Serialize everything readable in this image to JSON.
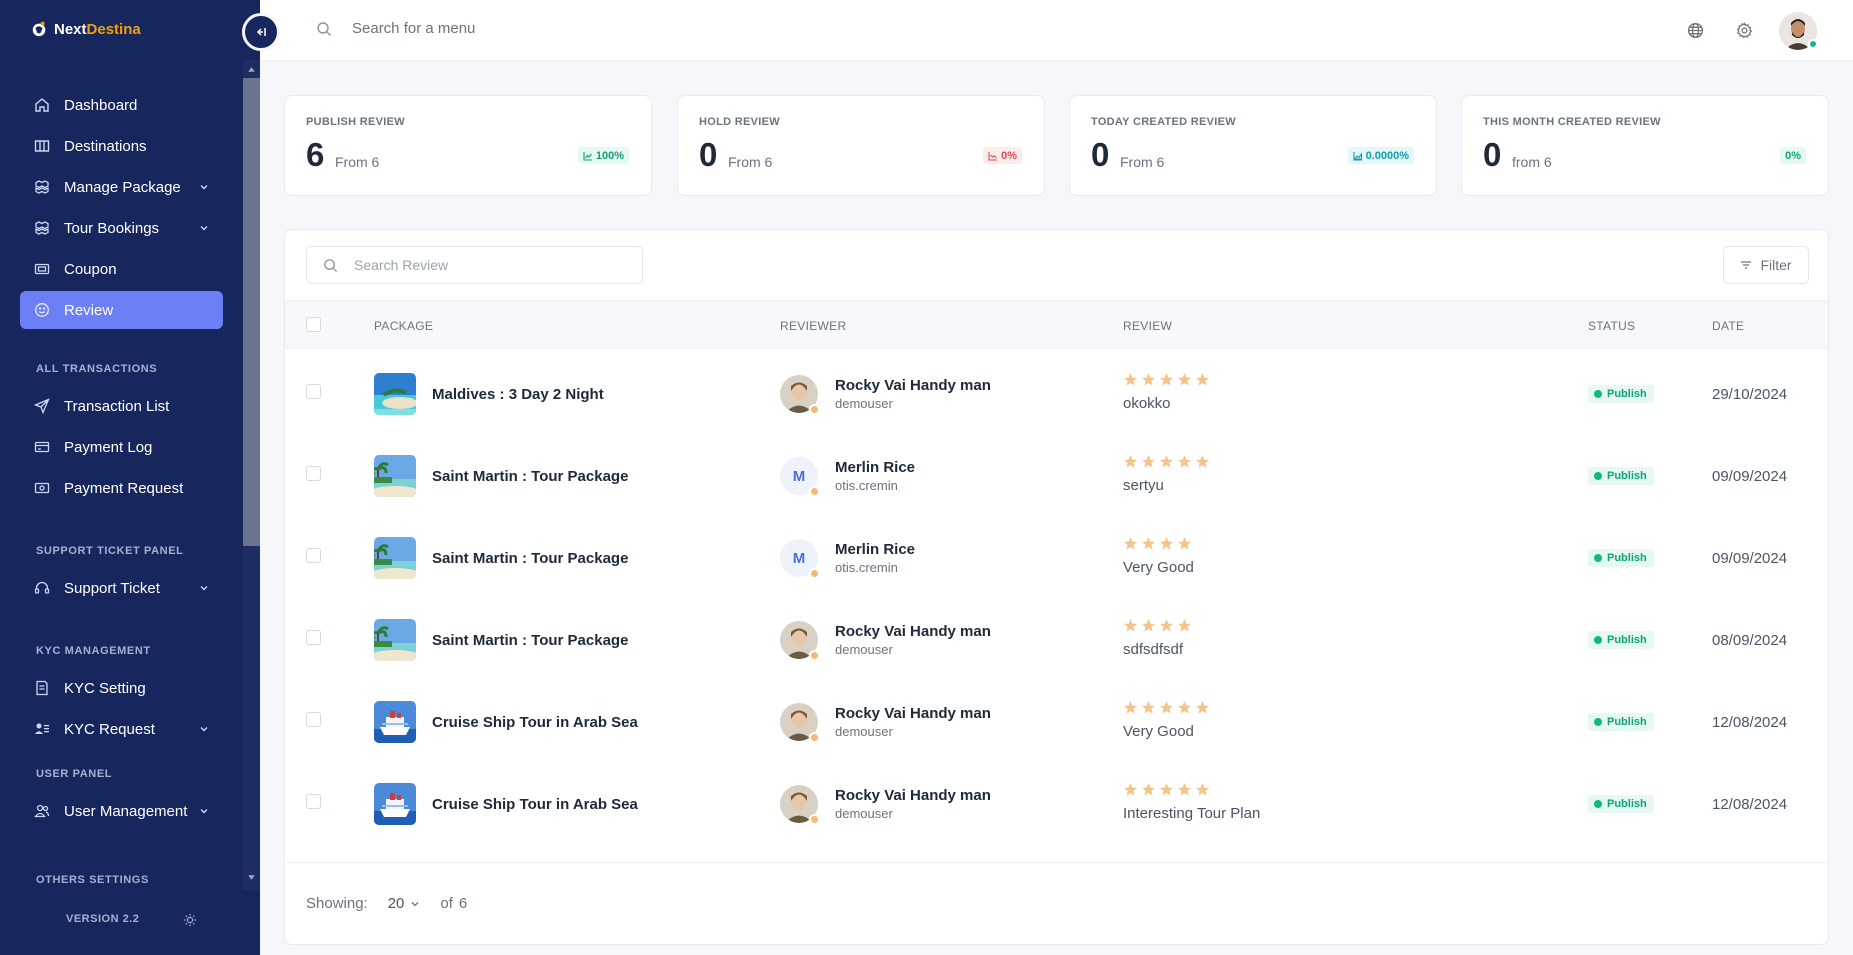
{
  "brand": {
    "part1": "Next",
    "part2": "Destina"
  },
  "topbar": {
    "search_placeholder": "Search for a menu"
  },
  "sidebar": {
    "items": [
      {
        "label": "Dashboard",
        "icon": "home-icon"
      },
      {
        "label": "Destinations",
        "icon": "map-icon"
      },
      {
        "label": "Manage Package",
        "icon": "package-icon",
        "has_submenu": true
      },
      {
        "label": "Tour Bookings",
        "icon": "package-icon",
        "has_submenu": true
      },
      {
        "label": "Coupon",
        "icon": "ticket-icon"
      },
      {
        "label": "Review",
        "icon": "smile-icon",
        "active": true
      }
    ],
    "section_transactions": "ALL TRANSACTIONS",
    "transactions": [
      {
        "label": "Transaction List",
        "icon": "send-icon"
      },
      {
        "label": "Payment Log",
        "icon": "card-icon"
      },
      {
        "label": "Payment Request",
        "icon": "cash-icon"
      }
    ],
    "section_support": "SUPPORT TICKET PANEL",
    "support": [
      {
        "label": "Support Ticket",
        "icon": "headset-icon",
        "has_submenu": true
      }
    ],
    "section_kyc": "KYC MANAGEMENT",
    "kyc": [
      {
        "label": "KYC Setting",
        "icon": "doc-icon"
      },
      {
        "label": "KYC Request",
        "icon": "user-list-icon",
        "has_submenu": true
      }
    ],
    "section_user": "USER PANEL",
    "user": [
      {
        "label": "User Management",
        "icon": "users-icon",
        "has_submenu": true
      }
    ],
    "section_others": "OTHERS SETTINGS",
    "version": "VERSION 2.2"
  },
  "stats": [
    {
      "title": "PUBLISH REVIEW",
      "value": "6",
      "sub": "From 6",
      "pct": "100%",
      "tone": "green"
    },
    {
      "title": "HOLD REVIEW",
      "value": "0",
      "sub": "From 6",
      "pct": "0%",
      "tone": "red"
    },
    {
      "title": "TODAY CREATED REVIEW",
      "value": "0",
      "sub": "From 6",
      "pct": "0.0000%",
      "tone": "teal"
    },
    {
      "title": "THIS MONTH CREATED REVIEW",
      "value": "0",
      "sub": "from 6",
      "pct": "0%",
      "tone": "green"
    }
  ],
  "table": {
    "search_placeholder": "Search Review",
    "filter_label": "Filter",
    "headers": {
      "package": "PACKAGE",
      "reviewer": "REVIEWER",
      "review": "REVIEW",
      "status": "STATUS",
      "date": "DATE"
    },
    "rows": [
      {
        "package": "Maldives : 3 Day 2 Night",
        "image": "beach-island-image",
        "reviewer": "Rocky Vai Handy man",
        "username": "demouser",
        "avatar": "photo",
        "stars": 5,
        "review": "okokko",
        "status": "Publish",
        "date": "29/10/2024"
      },
      {
        "package": "Saint Martin : Tour Package",
        "image": "palm-beach-image",
        "reviewer": "Merlin Rice",
        "username": "otis.cremin",
        "avatar": "M",
        "stars": 5,
        "review": "sertyu",
        "status": "Publish",
        "date": "09/09/2024"
      },
      {
        "package": "Saint Martin : Tour Package",
        "image": "palm-beach-image",
        "reviewer": "Merlin Rice",
        "username": "otis.cremin",
        "avatar": "M",
        "stars": 4,
        "review": "Very Good",
        "status": "Publish",
        "date": "09/09/2024"
      },
      {
        "package": "Saint Martin : Tour Package",
        "image": "palm-beach-image",
        "reviewer": "Rocky Vai Handy man",
        "username": "demouser",
        "avatar": "photo",
        "stars": 4,
        "review": "sdfsdfsdf",
        "status": "Publish",
        "date": "08/09/2024"
      },
      {
        "package": "Cruise Ship Tour in Arab Sea",
        "image": "cruise-ship-image",
        "reviewer": "Rocky Vai Handy man",
        "username": "demouser",
        "avatar": "photo",
        "stars": 5,
        "review": "Very Good",
        "status": "Publish",
        "date": "12/08/2024"
      },
      {
        "package": "Cruise Ship Tour in Arab Sea",
        "image": "cruise-ship-image",
        "reviewer": "Rocky Vai Handy man",
        "username": "demouser",
        "avatar": "photo",
        "stars": 5,
        "review": "Interesting Tour Plan",
        "status": "Publish",
        "date": "12/08/2024"
      }
    ]
  },
  "pagination": {
    "showing_label": "Showing:",
    "per_page": "20",
    "of_label": "of",
    "total": "6"
  },
  "colors": {
    "sidebar": "#17275d",
    "active": "#6d7ff5",
    "star": "#f5c48a",
    "publish": "#0fa37a"
  }
}
